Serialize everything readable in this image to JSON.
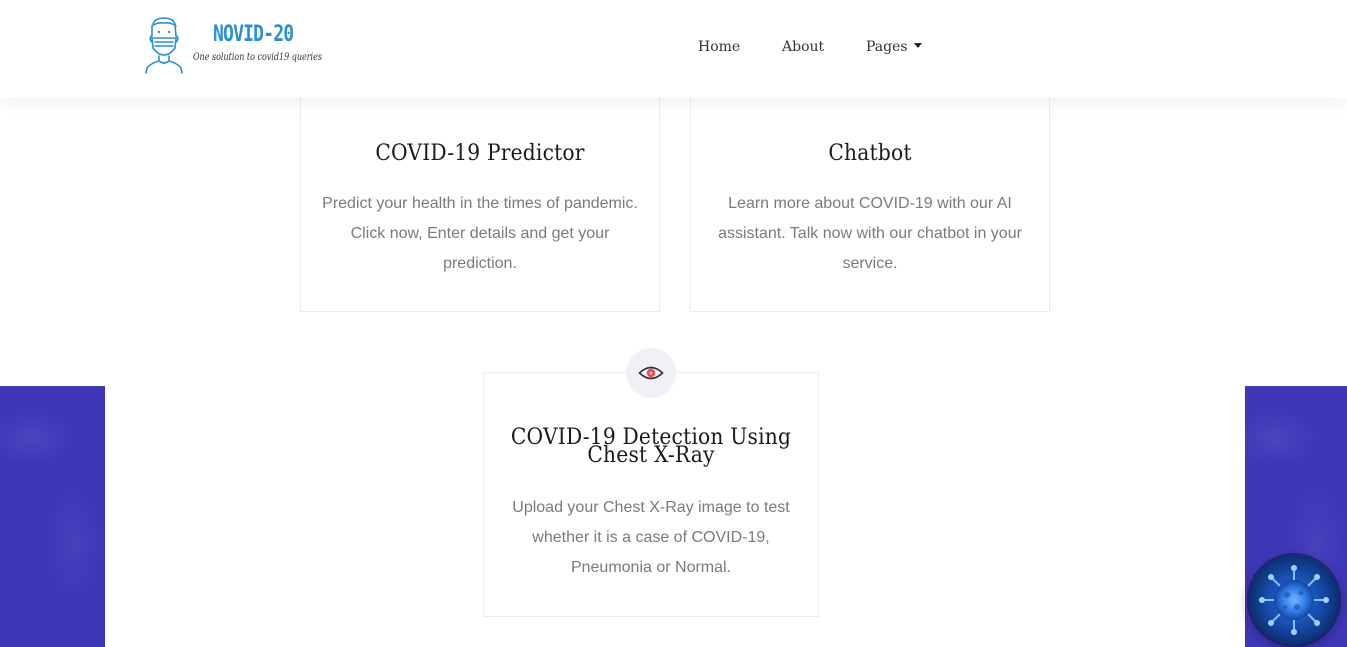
{
  "header": {
    "logo": {
      "title": "NOVID-20",
      "tagline": "One solution to covid19 queries"
    },
    "nav": {
      "home": "Home",
      "about": "About",
      "pages": "Pages"
    }
  },
  "cards": {
    "predictor": {
      "title": "COVID-19 Predictor",
      "description": "Predict your health in the times of pandemic. Click now, Enter details and get your prediction."
    },
    "chatbot": {
      "title": "Chatbot",
      "description": "Learn more about COVID-19 with our AI assistant. Talk now with our chatbot in your service."
    },
    "xray": {
      "title": "COVID-19 Detection Using Chest X-Ray",
      "description": "Upload your Chest X-Ray image to test whether it is a case of COVID-19, Pneumonia or Normal.",
      "icon": "eye-icon"
    }
  },
  "colors": {
    "accent_blue": "#2b8fd3",
    "band_purple": "#3e37b8",
    "icon_circle": "#eff1f6",
    "eye_red": "#e8474c",
    "text_muted": "#7a7a7a"
  }
}
